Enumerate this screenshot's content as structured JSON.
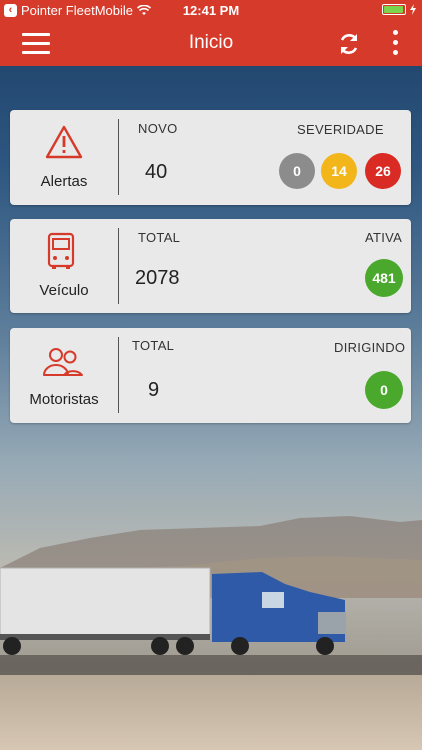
{
  "status_bar": {
    "carrier": "Pointer FleetMobile",
    "time": "12:41 PM",
    "battery_level": 0.85
  },
  "nav": {
    "title": "Inicio",
    "menu_icon": "hamburger-menu-icon",
    "refresh_icon": "refresh-icon",
    "more_icon": "more-vertical-icon"
  },
  "colors": {
    "brand": "#d63a2a",
    "badge_gray": "#8c8c8c",
    "badge_yellow": "#f2b51a",
    "badge_red": "#d92a24",
    "badge_green": "#4aa82c"
  },
  "cards": {
    "alertas": {
      "label": "Alertas",
      "icon": "warning-triangle-icon",
      "col1_header": "NOVO",
      "col1_value": "40",
      "col2_header": "SEVERIDADE",
      "severity": [
        "0",
        "14",
        "26"
      ]
    },
    "veiculo": {
      "label": "Veículo",
      "icon": "vehicle-icon",
      "col1_header": "TOTAL",
      "col1_value": "2078",
      "col2_header": "ATIVA",
      "badge": "481"
    },
    "motoristas": {
      "label": "Motoristas",
      "icon": "drivers-icon",
      "col1_header": "TOTAL",
      "col1_value": "9",
      "col2_header": "DIRIGINDO",
      "badge": "0"
    }
  }
}
